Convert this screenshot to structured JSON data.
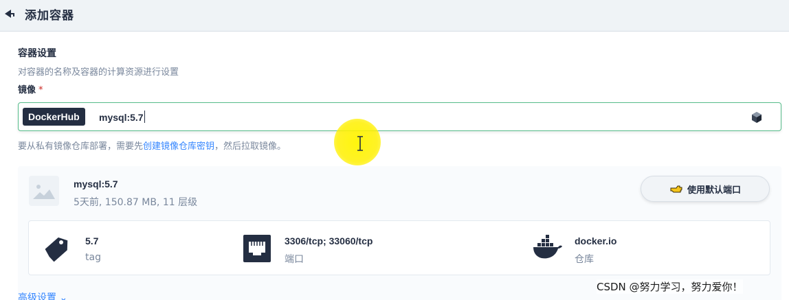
{
  "header": {
    "title": "添加容器"
  },
  "section": {
    "title": "容器设置",
    "description": "对容器的名称及容器的计算资源进行设置"
  },
  "image_field": {
    "label": "镜像",
    "required_mark": "*",
    "registry": "DockerHub",
    "value": "mysql:5.7"
  },
  "hint": {
    "prefix": "要从私有镜像仓库部署，需要先",
    "link": "创建镜像仓库密钥",
    "suffix": "，然后拉取镜像。"
  },
  "result": {
    "name": "mysql:5.7",
    "meta": "5天前, 150.87 MB, 11 层级",
    "default_port_button": "使用默认端口",
    "details": [
      {
        "value": "5.7",
        "label": "tag",
        "icon": "tag-icon"
      },
      {
        "value": "3306/tcp; 33060/tcp",
        "label": "端口",
        "icon": "ethernet-port-icon"
      },
      {
        "value": "docker.io",
        "label": "仓库",
        "icon": "docker-whale-icon"
      }
    ]
  },
  "advanced_settings": {
    "label": "高级设置"
  },
  "watermark": "CSDN @努力学习，努力爱你！",
  "colors": {
    "accent_border": "#55bc8a",
    "link": "#3385ff",
    "required": "#ca2621",
    "badge_bg": "#242e42",
    "highlight": "#fff000"
  }
}
